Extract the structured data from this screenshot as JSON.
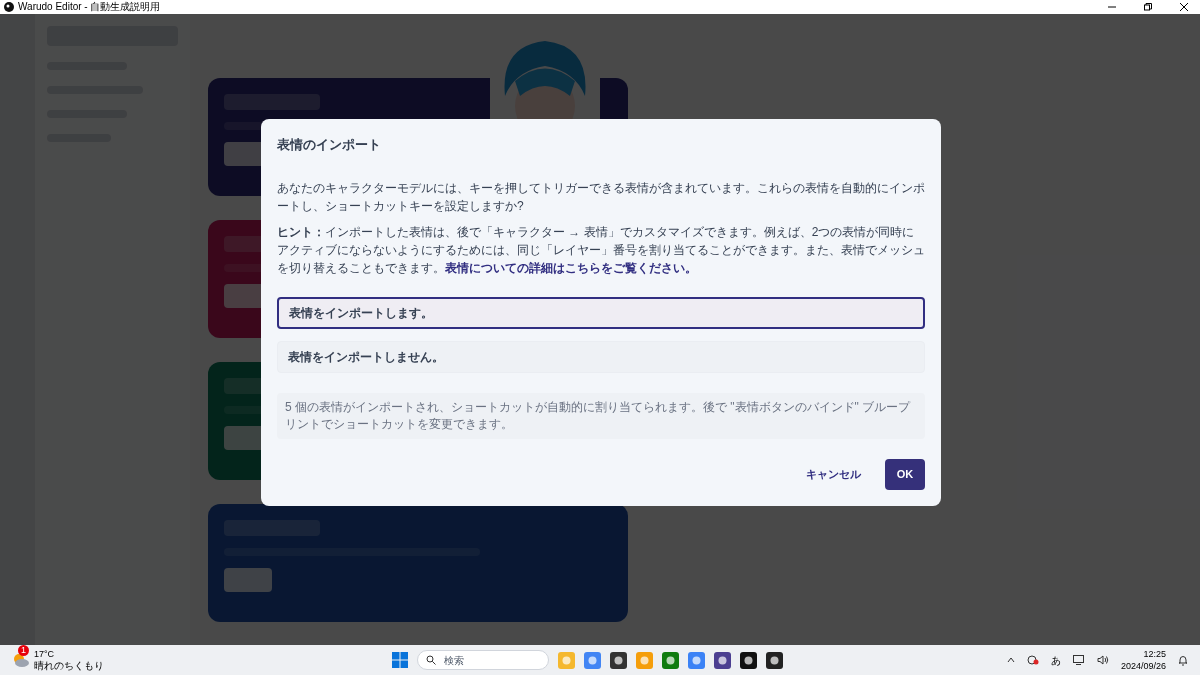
{
  "window": {
    "title": "Warudo Editor - 自動生成説明用"
  },
  "dialog": {
    "title": "表情のインポート",
    "description": "あなたのキャラクターモデルには、キーを押してトリガーできる表情が含まれています。これらの表情を自動的にインポートし、ショートカットキーを設定しますか?",
    "hint": "**ヒント：**インポートした表情は、後で「キャラクター → 表情」でカスタマイズできます。例えば、2つの表情が同時にアクティブにならないようにするためには、同じ「レイヤー」番号を割り当てることができます。また、表情でメッシュを切り替えることもできます。",
    "hint_link": "表情についての詳細はこちらをご覧ください。",
    "options": [
      {
        "label": "表情をインポートします。",
        "selected": true
      },
      {
        "label": "表情をインポートしません。",
        "selected": false
      }
    ],
    "note": "5 個の表情がインポートされ、ショートカットが自動的に割り当てられます。後で \"表情ボタンのバインド\" ブループリントでショートカットを変更できます。",
    "buttons": {
      "cancel": "キャンセル",
      "ok": "OK"
    }
  },
  "taskbar": {
    "weather": {
      "temperature": "17°C",
      "condition": "晴れのちくもり",
      "badge": "1"
    },
    "search": {
      "placeholder": "検索"
    },
    "ime": "あ",
    "time": "12:25",
    "date": "2024/09/26"
  }
}
